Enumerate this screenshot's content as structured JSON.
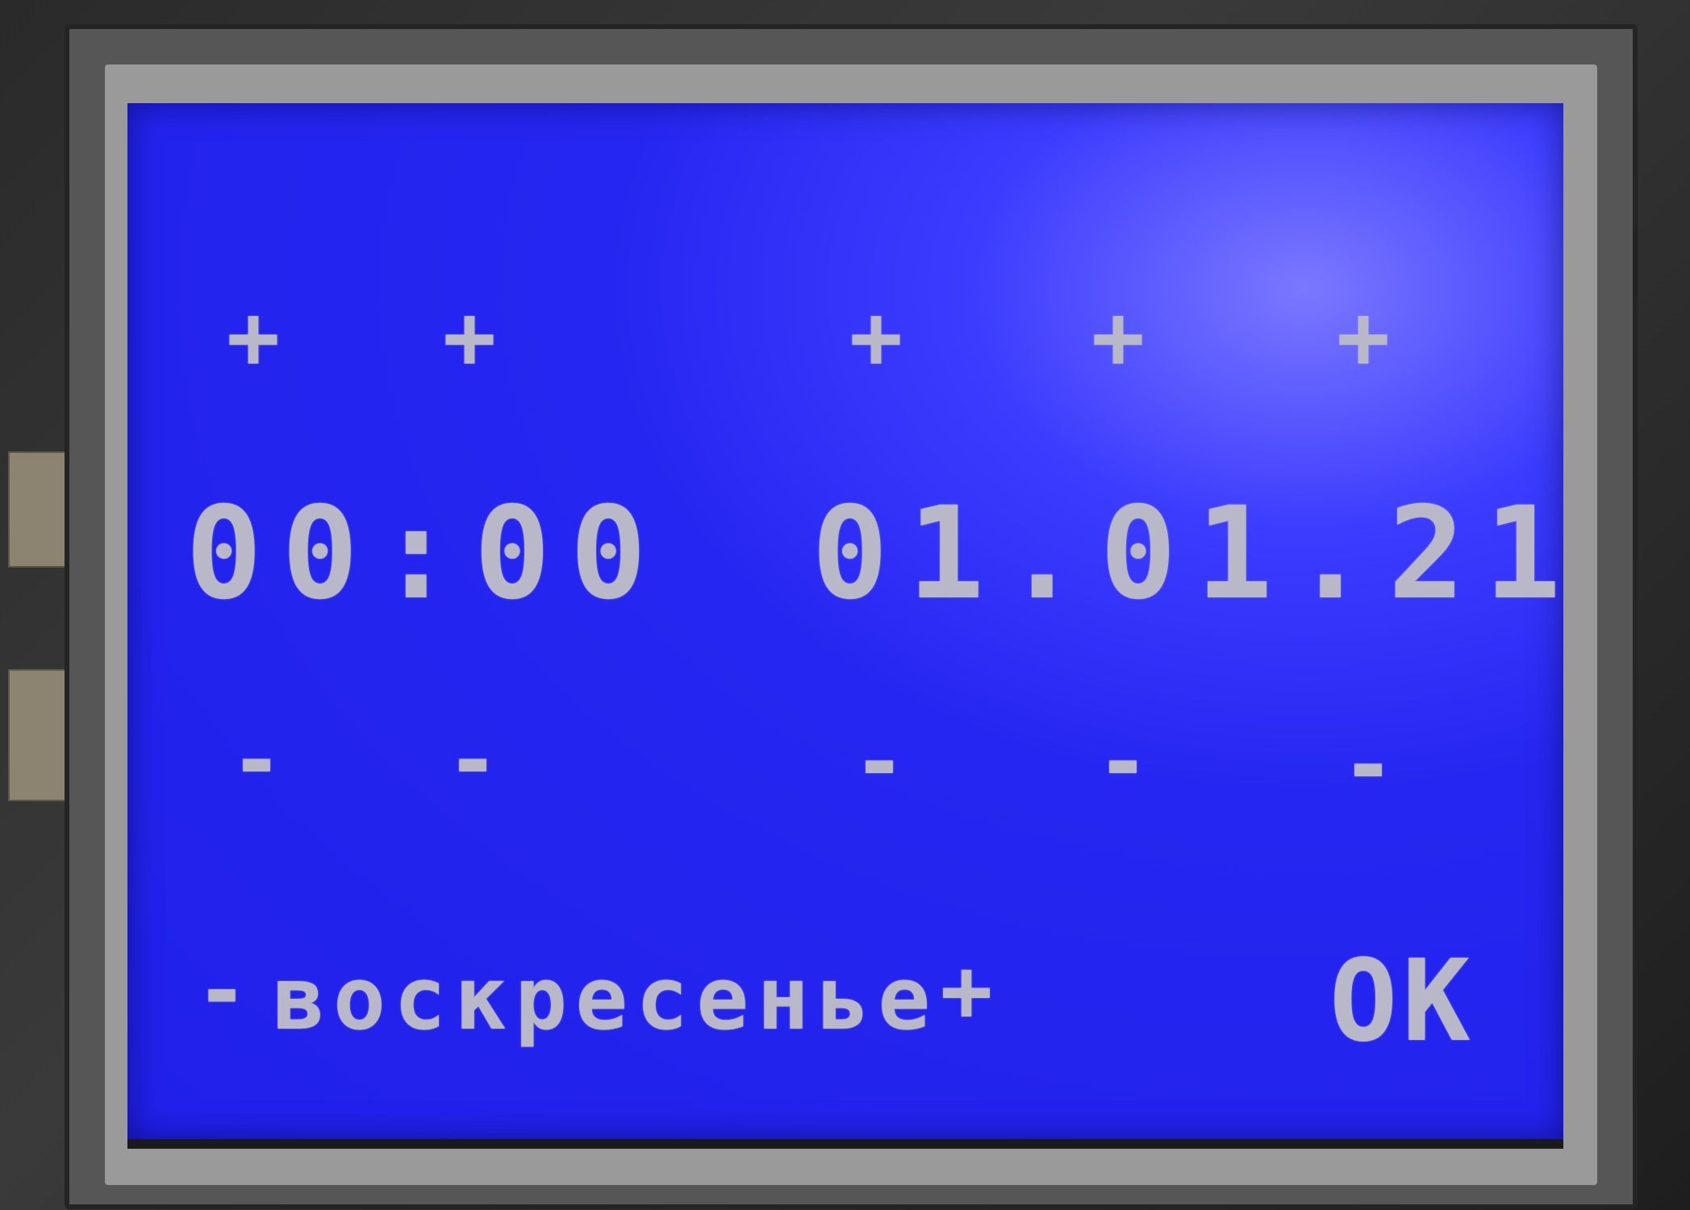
{
  "controls": {
    "time_hour_plus": "+",
    "time_minute_plus": "+",
    "date_day_plus": "+",
    "date_month_plus": "+",
    "date_year_plus": "+",
    "time_hour_minus": "-",
    "time_minute_minus": "-",
    "date_day_minus": "-",
    "date_month_minus": "-",
    "date_year_minus": "-",
    "weekday_minus": "-",
    "weekday_plus": "+",
    "ok_label": "OK"
  },
  "display": {
    "time": "00:00",
    "date": "01.01.21",
    "weekday": "воскресенье"
  },
  "colors": {
    "lcd_background": "#2020ea",
    "lcd_text": "#b8b8c8"
  }
}
